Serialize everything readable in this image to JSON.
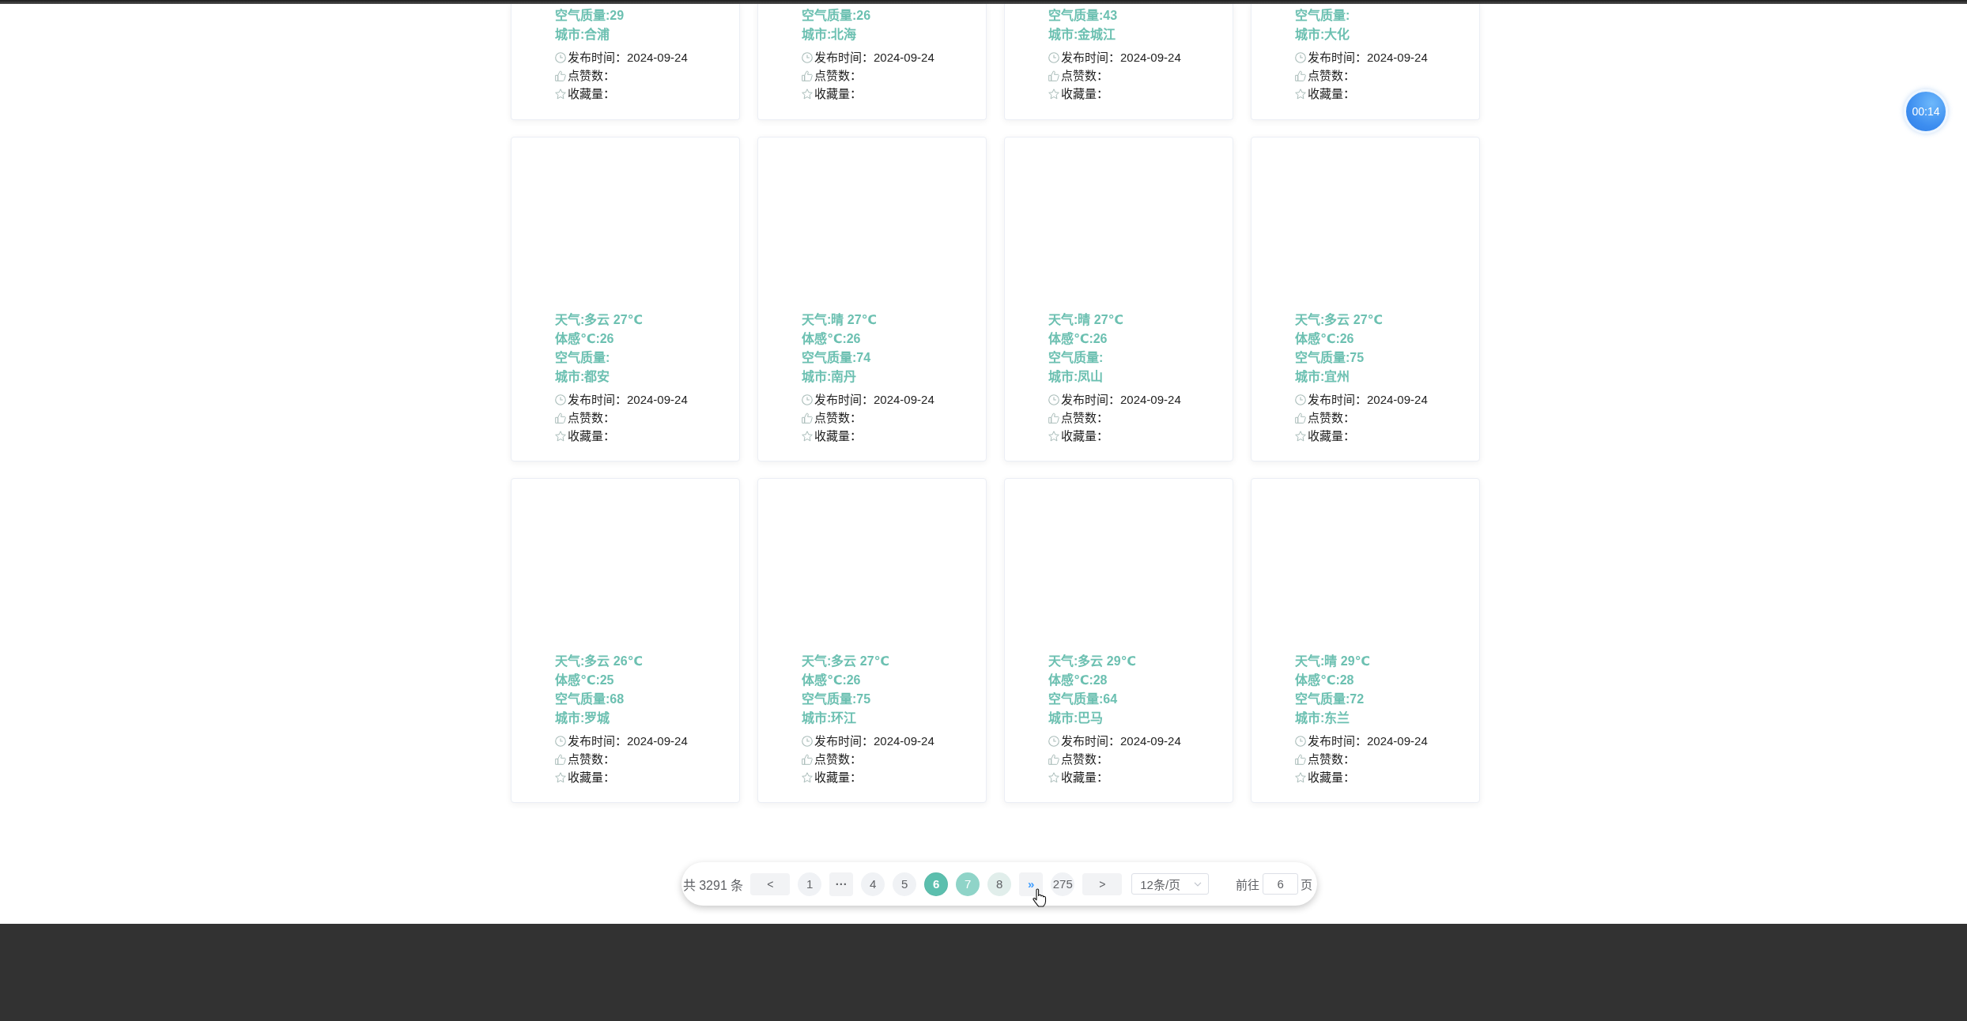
{
  "cards": [
    {
      "air_quality": "空气质量:29",
      "city": "城市:合浦",
      "published": "发布时间：2024-09-24",
      "likes": "点赞数：",
      "favorites": "收藏量："
    },
    {
      "air_quality": "空气质量:26",
      "city": "城市:北海",
      "published": "发布时间：2024-09-24",
      "likes": "点赞数：",
      "favorites": "收藏量："
    },
    {
      "air_quality": "空气质量:43",
      "city": "城市:金城江",
      "published": "发布时间：2024-09-24",
      "likes": "点赞数：",
      "favorites": "收藏量："
    },
    {
      "air_quality": "空气质量:",
      "city": "城市:大化",
      "published": "发布时间：2024-09-24",
      "likes": "点赞数：",
      "favorites": "收藏量："
    },
    {
      "weather": "天气:多云 27℃",
      "feels": "体感℃:26",
      "air_quality": "空气质量:",
      "city": "城市:都安",
      "published": "发布时间：2024-09-24",
      "likes": "点赞数：",
      "favorites": "收藏量："
    },
    {
      "weather": "天气:晴 27℃",
      "feels": "体感℃:26",
      "air_quality": "空气质量:74",
      "city": "城市:南丹",
      "published": "发布时间：2024-09-24",
      "likes": "点赞数：",
      "favorites": "收藏量："
    },
    {
      "weather": "天气:晴 27℃",
      "feels": "体感℃:26",
      "air_quality": "空气质量:",
      "city": "城市:凤山",
      "published": "发布时间：2024-09-24",
      "likes": "点赞数：",
      "favorites": "收藏量："
    },
    {
      "weather": "天气:多云 27℃",
      "feels": "体感℃:26",
      "air_quality": "空气质量:75",
      "city": "城市:宜州",
      "published": "发布时间：2024-09-24",
      "likes": "点赞数：",
      "favorites": "收藏量："
    },
    {
      "weather": "天气:多云 26℃",
      "feels": "体感℃:25",
      "air_quality": "空气质量:68",
      "city": "城市:罗城",
      "published": "发布时间：2024-09-24",
      "likes": "点赞数：",
      "favorites": "收藏量："
    },
    {
      "weather": "天气:多云 27℃",
      "feels": "体感℃:26",
      "air_quality": "空气质量:75",
      "city": "城市:环江",
      "published": "发布时间：2024-09-24",
      "likes": "点赞数：",
      "favorites": "收藏量："
    },
    {
      "weather": "天气:多云 29℃",
      "feels": "体感℃:28",
      "air_quality": "空气质量:64",
      "city": "城市:巴马",
      "published": "发布时间：2024-09-24",
      "likes": "点赞数：",
      "favorites": "收藏量："
    },
    {
      "weather": "天气:晴 29℃",
      "feels": "体感℃:28",
      "air_quality": "空气质量:72",
      "city": "城市:东兰",
      "published": "发布时间：2024-09-24",
      "likes": "点赞数：",
      "favorites": "收藏量："
    }
  ],
  "pagination": {
    "total": "共 3291 条",
    "items": [
      {
        "kind": "prev",
        "label": "<",
        "selected": false,
        "hovered": false,
        "color": "#f2f3f5"
      },
      {
        "kind": "page",
        "label": "1",
        "selected": false,
        "hovered": false,
        "color": "#f0f2f5"
      },
      {
        "kind": "more",
        "label": "···",
        "selected": false,
        "hovered": false,
        "color": "#f2f3f5"
      },
      {
        "kind": "page",
        "label": "4",
        "selected": false,
        "hovered": false,
        "color": "#f0f2f5"
      },
      {
        "kind": "page",
        "label": "5",
        "selected": false,
        "hovered": false,
        "color": "#f0f2f5"
      },
      {
        "kind": "page",
        "label": "6",
        "selected": true,
        "hovered": false,
        "color": "#5cbfae"
      },
      {
        "kind": "page",
        "label": "7",
        "selected": false,
        "hovered": false,
        "color": "#8fd4c8"
      },
      {
        "kind": "page",
        "label": "8",
        "selected": false,
        "hovered": false,
        "color": "#e1eeeb"
      },
      {
        "kind": "more",
        "label": "»",
        "selected": false,
        "hovered": true,
        "color": "#f2f3f5"
      },
      {
        "kind": "page",
        "label": "275",
        "selected": false,
        "hovered": false,
        "color": "#f0f2f5"
      },
      {
        "kind": "next",
        "label": ">",
        "selected": false,
        "hovered": false,
        "color": "#f2f3f5"
      }
    ],
    "page_size": "12条/页",
    "goto_label": "前往",
    "goto_value": "6",
    "goto_suffix": "页"
  },
  "timer": "00:14"
}
